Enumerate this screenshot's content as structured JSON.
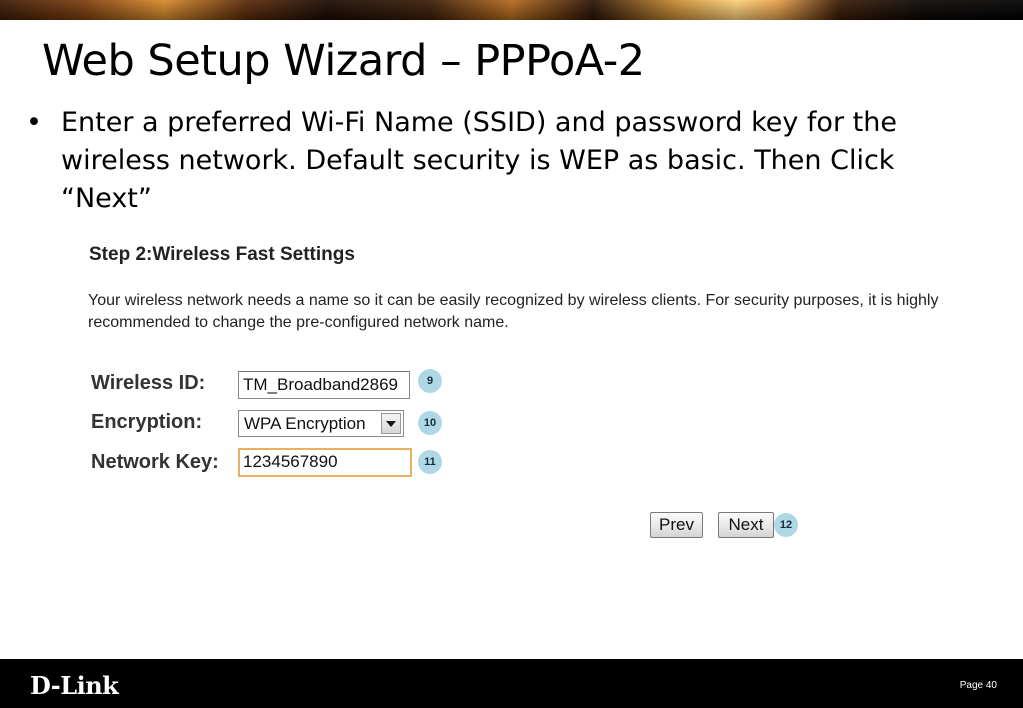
{
  "slide": {
    "title": "Web Setup Wizard – PPPoA-2",
    "bullet_symbol": "•",
    "bullet_text": "Enter a preferred Wi-Fi Name (SSID) and password key for the wireless network. Default security is WEP as basic. Then Click “Next”"
  },
  "wizard": {
    "step_title": "Step 2:Wireless Fast Settings",
    "description": "Your wireless network needs a name so it can be easily recognized by wireless clients. For security purposes, it is highly recommended to change the pre-configured network name.",
    "fields": {
      "wireless_id": {
        "label": "Wireless ID:",
        "value": "TM_Broadband2869",
        "badge": "9"
      },
      "encryption": {
        "label": "Encryption:",
        "value": "WPA Encryption",
        "badge": "10"
      },
      "network_key": {
        "label": "Network Key:",
        "value": "1234567890",
        "badge": "11"
      }
    },
    "buttons": {
      "prev": "Prev",
      "next": "Next",
      "next_badge": "12"
    }
  },
  "footer": {
    "logo": "D-Link",
    "page": "Page 40"
  },
  "colors": {
    "badge": "#aed8e6",
    "focus_border": "#e8b060",
    "footer_bg": "#000000"
  }
}
